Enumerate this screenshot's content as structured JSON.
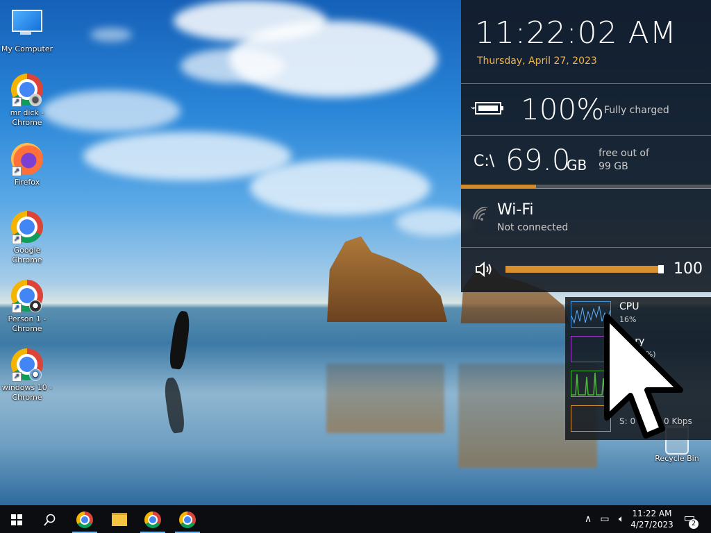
{
  "desktop": {
    "icons": [
      {
        "label": "My Computer",
        "icon": "monitor-icon"
      },
      {
        "label": "mr dick - Chrome",
        "icon": "chrome-icon"
      },
      {
        "label": "Firefox",
        "icon": "firefox-icon"
      },
      {
        "label": "Google Chrome",
        "icon": "chrome-icon"
      },
      {
        "label": "Person 1 - Chrome",
        "icon": "chrome-icon"
      },
      {
        "label": "windows 10 - Chrome",
        "icon": "chrome-icon"
      },
      {
        "label": "Recycle Bin",
        "icon": "recycle-bin-icon"
      }
    ]
  },
  "widget": {
    "time": "11:22:02 AM",
    "date": "Thursday, April 27, 2023",
    "battery": {
      "percent_text": "100%",
      "status": "Fully charged",
      "level": 1.0
    },
    "disk": {
      "label": "C:\\",
      "free": "69.0",
      "unit": "GB",
      "text_line1": "free out of",
      "text_line2": "99 GB",
      "used_fraction": 0.3
    },
    "wifi": {
      "name": "Wi-Fi",
      "status": "Not connected",
      "icon": "wifi-icon"
    },
    "volume": {
      "value": "100",
      "level": 1.0,
      "icon": "speaker-icon"
    }
  },
  "perf": {
    "cpu": {
      "label": "CPU",
      "value": "16%"
    },
    "memory": {
      "label": "mory",
      "value": "GB (60%)"
    },
    "network": {
      "value": "S: 0",
      "value_right": "0 Kbps"
    }
  },
  "colors": {
    "accent_orange": "#d8902e",
    "date_color": "#f0b34a",
    "cpu_color": "#3a8fd8",
    "memory_color": "#a03cc8",
    "disk_color": "#4cbb3a",
    "net_color": "#d8902e"
  },
  "taskbar": {
    "start_icon": "windows-logo-icon",
    "search_icon": "search-icon",
    "apps": [
      "chrome-icon",
      "file-explorer-icon",
      "chrome-icon",
      "chrome-icon"
    ],
    "tray_icons": [
      "chevron-up-icon",
      "network-icon",
      "speaker-icon"
    ],
    "clock_time": "11:22 AM",
    "clock_date": "4/27/2023",
    "notification_count": "2"
  }
}
